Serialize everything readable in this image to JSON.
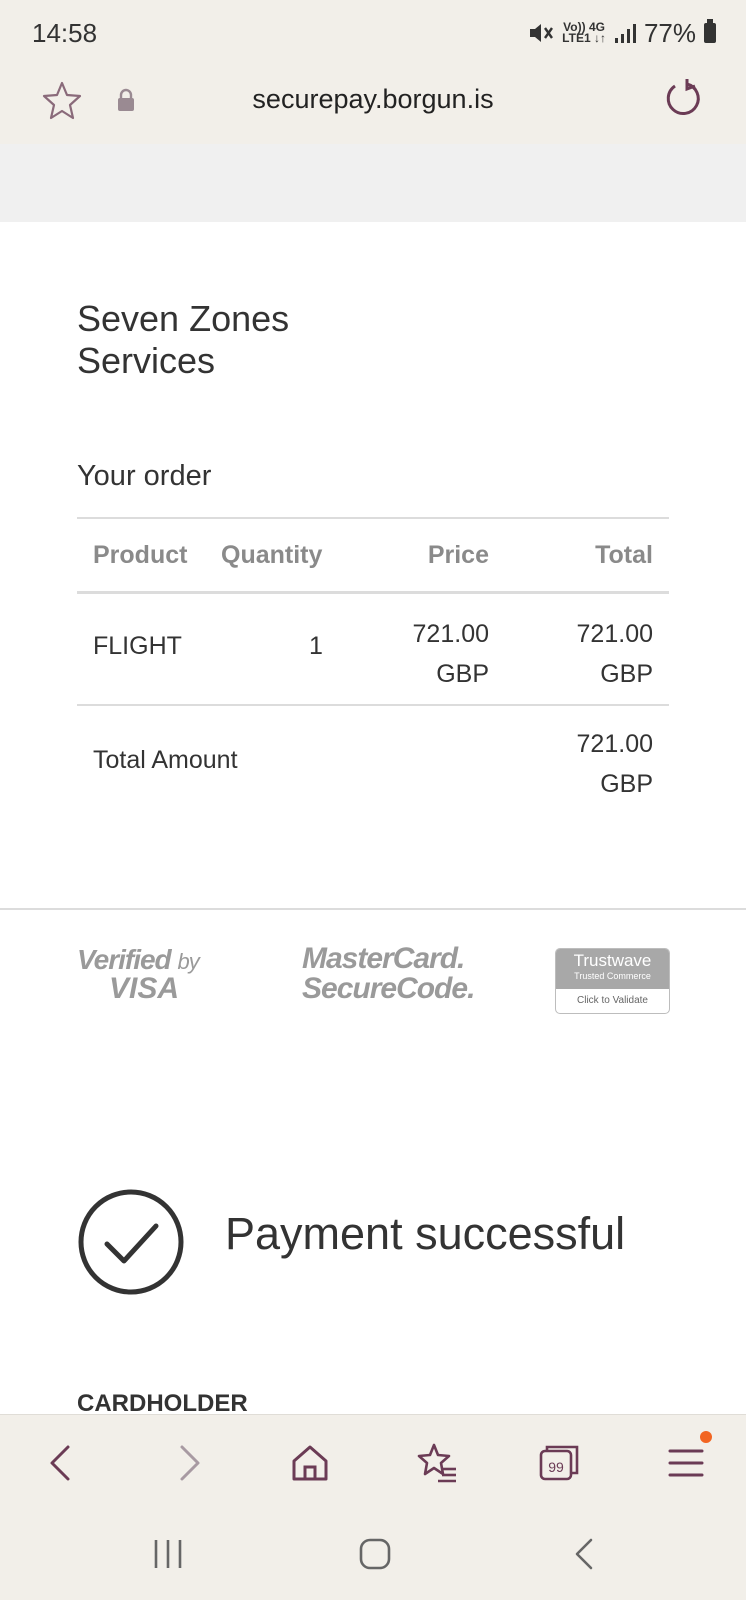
{
  "status_bar": {
    "time": "14:58",
    "network_tag_top": "Vo)) 4G",
    "network_tag_bottom": "LTE1 ↓↑",
    "battery": "77%"
  },
  "browser": {
    "url": "securepay.borgun.is"
  },
  "page": {
    "merchant_line1": "Seven Zones",
    "merchant_line2": "Services",
    "order_title": "Your order",
    "table": {
      "headers": {
        "product": "Product",
        "quantity": "Quantity",
        "price": "Price",
        "total": "Total"
      },
      "rows": [
        {
          "product": "FLIGHT",
          "quantity": "1",
          "price_amount": "721.00",
          "price_currency": "GBP",
          "total_amount": "721.00",
          "total_currency": "GBP"
        }
      ],
      "total_label": "Total Amount",
      "total_amount": "721.00",
      "total_currency": "GBP"
    },
    "logos": {
      "visa_line1": "Verified",
      "visa_by": "by",
      "visa_line2": "VISA",
      "mc_line1": "MasterCard.",
      "mc_line2": "SecureCode.",
      "trustwave_name": "Trustwave",
      "trustwave_sub": "Trusted Commerce",
      "trustwave_cta": "Click to Validate"
    },
    "success_message": "Payment successful",
    "cardholder_label": "CARDHOLDER"
  },
  "toolbar": {
    "tabs_count": "99"
  },
  "colors": {
    "chrome_bg": "#f2efe9",
    "icon_color": "#6b3b55",
    "notification_dot": "#f26522"
  }
}
